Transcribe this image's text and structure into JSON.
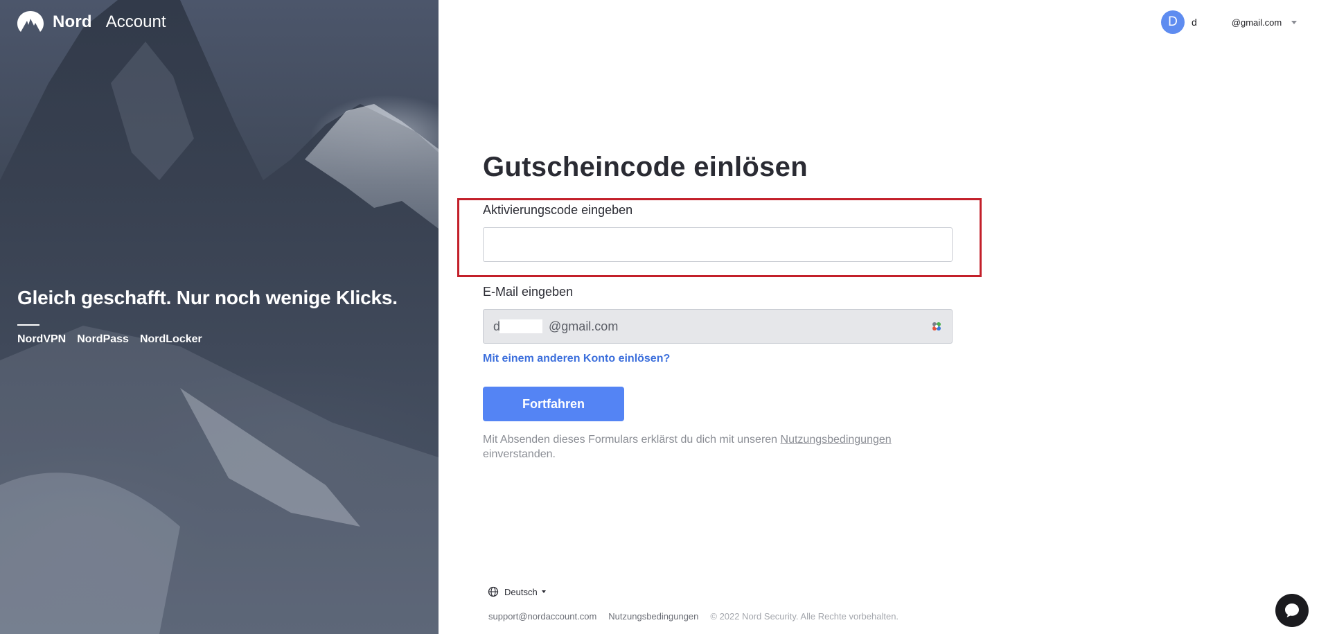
{
  "brand": {
    "name": "Nord",
    "product": "Account",
    "logo_icon": "nord-mountain-logo"
  },
  "hero": {
    "tagline": "Gleich geschafft. Nur noch wenige Klicks.",
    "products": [
      "NordVPN",
      "NordPass",
      "NordLocker"
    ]
  },
  "user": {
    "avatar_letter": "D",
    "initial": "d",
    "email": "@gmail.com",
    "avatar_color": "#5e8cf0"
  },
  "form": {
    "title": "Gutscheincode einlösen",
    "activation_label": "Aktivierungscode eingeben",
    "activation_value": "",
    "email_label": "E-Mail eingeben",
    "email_value": "d              @gmail.com",
    "alt_account_link": "Mit einem anderen Konto einlösen?",
    "submit_label": "Fortfahren",
    "terms_prefix": "Mit Absenden dieses Formulars erklärst du dich mit unseren",
    "terms_link": "Nutzungsbedingungen",
    "terms_suffix": "einverstanden."
  },
  "footer": {
    "language": "Deutsch",
    "support_email": "support@nordaccount.com",
    "terms": "Nutzungsbedingungen",
    "copyright": "© 2022 Nord Security. Alle Rechte vorbehalten."
  },
  "colors": {
    "accent": "#5484f4",
    "link": "#3c6fdc",
    "highlight": "#c3202a"
  }
}
